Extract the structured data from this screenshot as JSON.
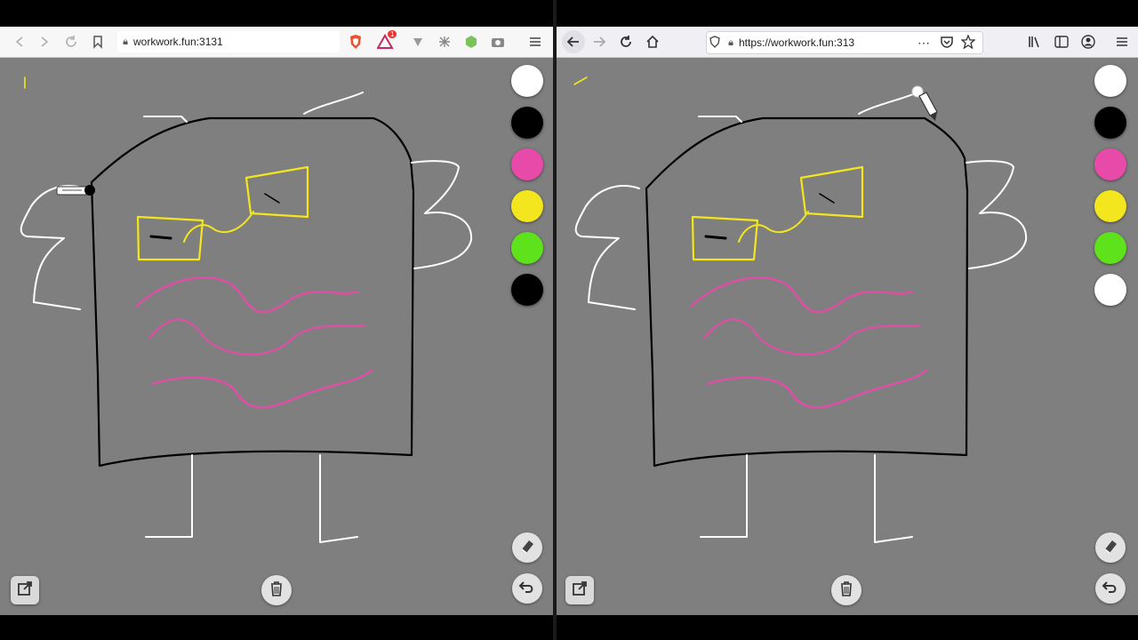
{
  "left_window": {
    "url": "workwork.fun:3131",
    "notification_count": "1"
  },
  "right_window": {
    "url": "https://workwork.fun:313"
  },
  "palette": {
    "colors": [
      "#ffffff",
      "#000000",
      "#e84aa9",
      "#f3e61f",
      "#5de21c",
      "#000000"
    ],
    "right_colors": [
      "#ffffff",
      "#000000",
      "#e84aa9",
      "#f3e61f",
      "#5de21c",
      "#ffffff"
    ]
  },
  "canvas_color": "#7f7f7f",
  "icons": {
    "share": "share-icon",
    "trash": "trash-icon",
    "eraser": "eraser-icon",
    "undo": "undo-icon"
  }
}
